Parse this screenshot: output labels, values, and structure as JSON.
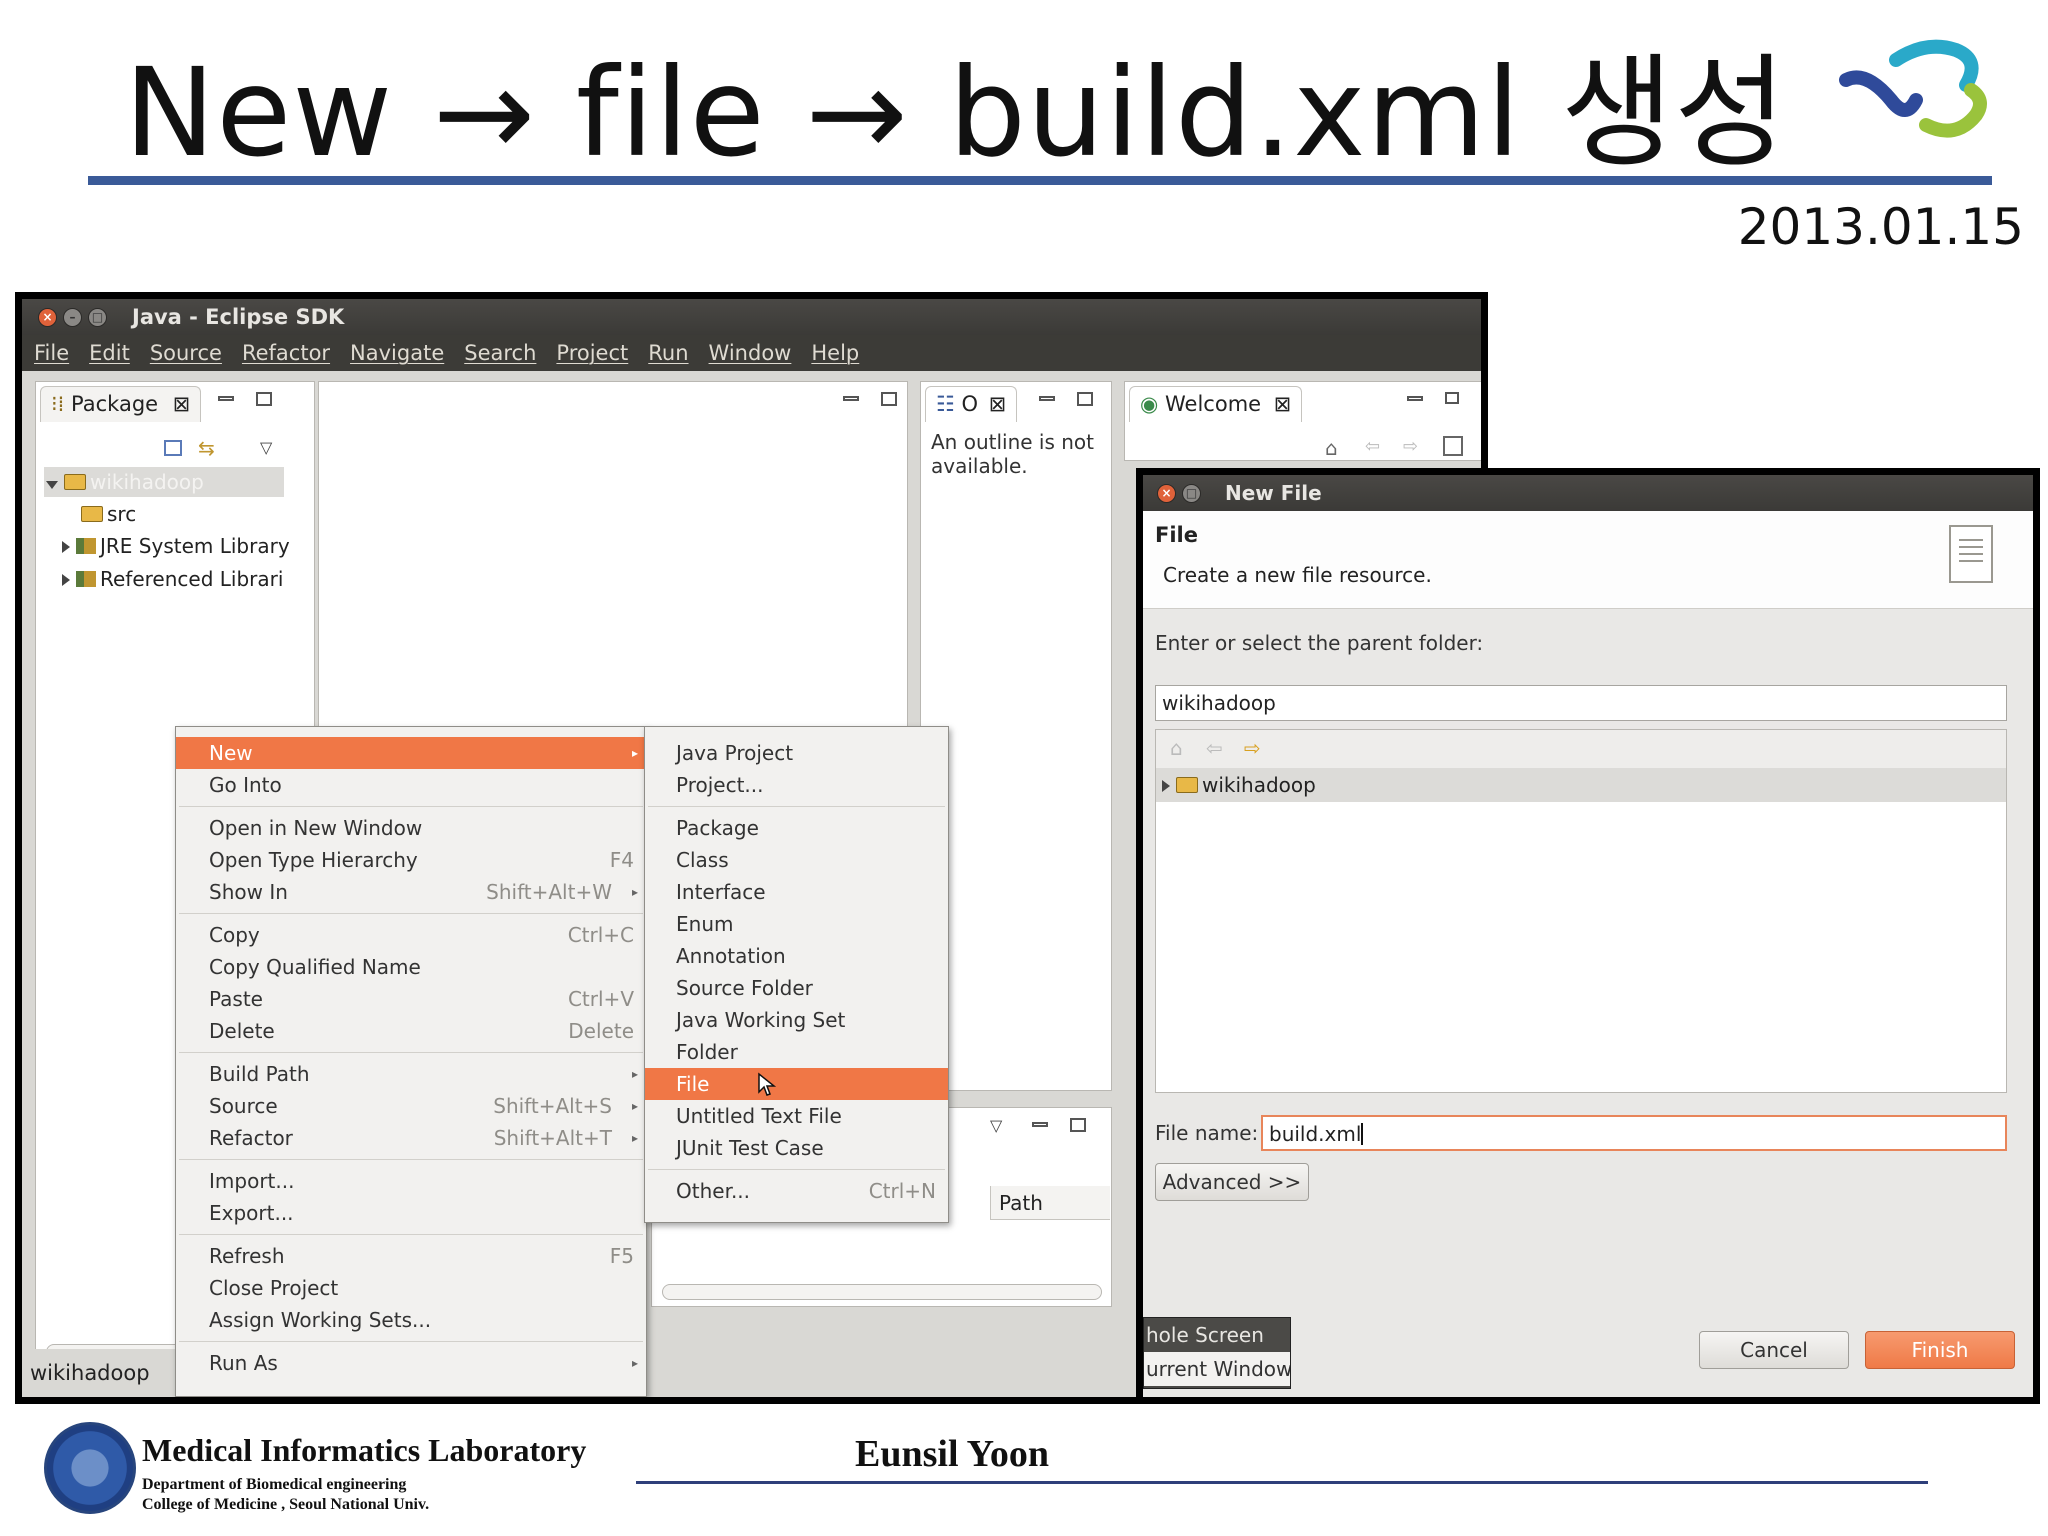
{
  "slide": {
    "title": "New → file → build.xml 생성",
    "date": "2013.01.15"
  },
  "eclipse": {
    "window_title": "Java - Eclipse SDK",
    "menu": [
      "File",
      "Edit",
      "Source",
      "Refactor",
      "Navigate",
      "Search",
      "Project",
      "Run",
      "Window",
      "Help"
    ],
    "package_tab": "Package",
    "outline_tab": "O",
    "outline_message_1": "An outline is not",
    "outline_message_2": "available.",
    "welcome_tab": "Welcome",
    "tree": {
      "project": "wikihadoop",
      "items": [
        "src",
        "JRE System Library",
        "Referenced Librari"
      ]
    },
    "bottom_column": "Path",
    "status": "wikihadoop"
  },
  "context_menu": {
    "items": [
      {
        "label": "New",
        "submenu": true,
        "highlighted": true
      },
      {
        "label": "Go Into"
      },
      {
        "separator": true
      },
      {
        "label": "Open in New Window"
      },
      {
        "label": "Open Type Hierarchy",
        "accel": "F4"
      },
      {
        "label": "Show In",
        "accel": "Shift+Alt+W",
        "submenu": true
      },
      {
        "separator": true
      },
      {
        "label": "Copy",
        "accel": "Ctrl+C"
      },
      {
        "label": "Copy Qualified Name"
      },
      {
        "label": "Paste",
        "accel": "Ctrl+V"
      },
      {
        "label": "Delete",
        "accel": "Delete"
      },
      {
        "separator": true
      },
      {
        "label": "Build Path",
        "submenu": true
      },
      {
        "label": "Source",
        "accel": "Shift+Alt+S",
        "submenu": true
      },
      {
        "label": "Refactor",
        "accel": "Shift+Alt+T",
        "submenu": true
      },
      {
        "separator": true
      },
      {
        "label": "Import..."
      },
      {
        "label": "Export..."
      },
      {
        "separator": true
      },
      {
        "label": "Refresh",
        "accel": "F5"
      },
      {
        "label": "Close Project"
      },
      {
        "label": "Assign Working Sets..."
      },
      {
        "separator": true
      },
      {
        "label": "Run As",
        "submenu": true
      }
    ]
  },
  "new_submenu": {
    "items": [
      {
        "label": "Java Project"
      },
      {
        "label": "Project..."
      },
      {
        "separator": true
      },
      {
        "label": "Package"
      },
      {
        "label": "Class"
      },
      {
        "label": "Interface"
      },
      {
        "label": "Enum"
      },
      {
        "label": "Annotation"
      },
      {
        "label": "Source Folder"
      },
      {
        "label": "Java Working Set"
      },
      {
        "label": "Folder"
      },
      {
        "label": "File",
        "highlighted": true
      },
      {
        "label": "Untitled Text File"
      },
      {
        "label": "JUnit Test Case"
      },
      {
        "separator": true
      },
      {
        "label": "Other...",
        "accel": "Ctrl+N"
      }
    ]
  },
  "new_file_dialog": {
    "window_title": "New File",
    "header_title": "File",
    "header_desc": "Create a new file resource.",
    "parent_label": "Enter or select the parent folder:",
    "parent_value": "wikihadoop",
    "tree_item": "wikihadoop",
    "filename_label": "File name:",
    "filename_value": "build.xml",
    "advanced_button": "Advanced >>",
    "cancel_button": "Cancel",
    "finish_button": "Finish",
    "strip_1": "hole Screen",
    "strip_2": "urrent Window"
  },
  "footer": {
    "lab": "Medical  Informatics Laboratory",
    "dept": "Department of Biomedical engineering",
    "college": "College of Medicine , Seoul  National  Univ.",
    "author": "Eunsil Yoon"
  },
  "colors": {
    "accent_orange": "#f07746",
    "title_rule": "#3a5a98",
    "titlebar": "#3c3b37"
  }
}
